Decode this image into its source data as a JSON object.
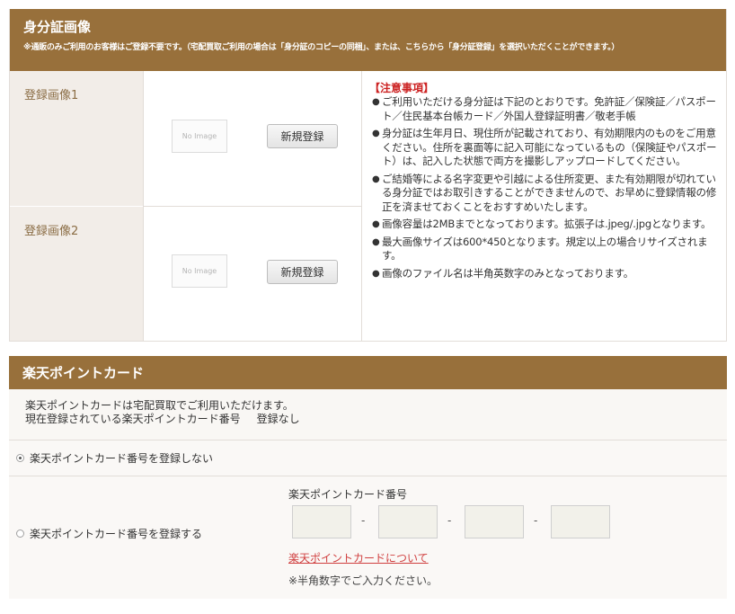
{
  "id_section": {
    "title": "身分証画像",
    "note": "※通販のみご利用のお客様はご登録不要です。（宅配買取ご利用の場合は「身分証のコピーの同梱」、または、こちらから「身分証登録」を選択いただくことができます。）",
    "rows": [
      {
        "label": "登録画像1",
        "placeholder_text": "No Image",
        "button_label": "新規登録"
      },
      {
        "label": "登録画像2",
        "placeholder_text": "No Image",
        "button_label": "新規登録"
      }
    ],
    "notes_title": "【注意事項】",
    "notes": [
      "ご利用いただける身分証は下記のとおりです。免許証／保険証／パスポート／住民基本台帳カード／外国人登録証明書／敬老手帳",
      "身分証は生年月日、現住所が記載されており、有効期限内のものをご用意ください。住所を裏面等に記入可能になっているもの（保険証やパスポート）は、記入した状態で両方を撮影しアップロードしてください。",
      "ご結婚等による名字変更や引越による住所変更、また有効期限が切れている身分証ではお取引きすることができませんので、お早めに登録情報の修正を済ませておくことをおすすめいたします。",
      "画像容量は2MBまでとなっております。拡張子は.jpeg/.jpgとなります。",
      "最大画像サイズは600*450となります。規定以上の場合リサイズされます。",
      "画像のファイル名は半角英数字のみとなっております。"
    ]
  },
  "rakuten_section": {
    "title": "楽天ポイントカード",
    "desc_line1": "楽天ポイントカードは宅配買取でご利用いただけます。",
    "desc_line2": "現在登録されている楽天ポイントカード番号",
    "registration_status": "登録なし",
    "option_no_register": "楽天ポイントカード番号を登録しない",
    "option_register": "楽天ポイントカード番号を登録する",
    "card_number_label": "楽天ポイントカード番号",
    "separator": "-",
    "about_link": "楽天ポイントカードについて",
    "half_width_note": "※半角数字でご入力ください。"
  }
}
